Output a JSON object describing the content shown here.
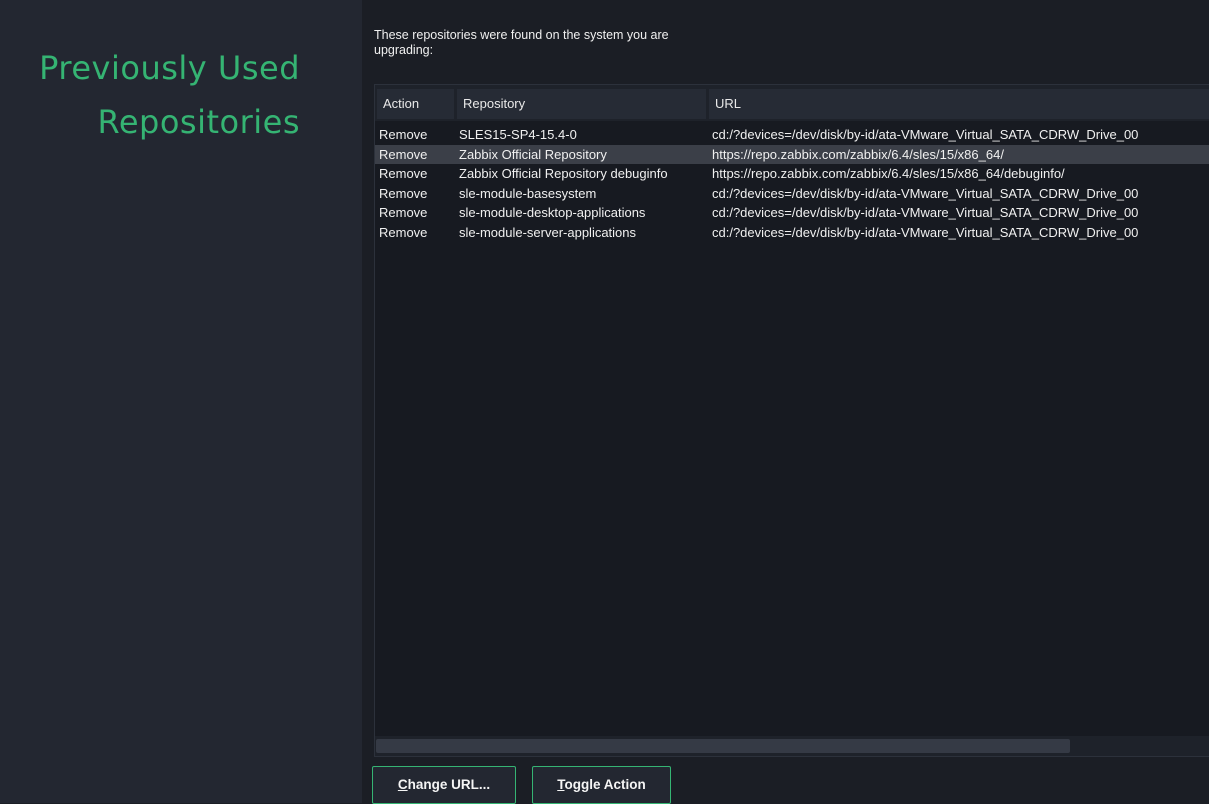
{
  "sidebar": {
    "title": "Previously Used\n  Repositories"
  },
  "intro_text": "These repositories were found on the system you are upgrading:",
  "table": {
    "columns": [
      "Action",
      "Repository",
      "URL"
    ],
    "rows": [
      {
        "action": "Remove",
        "repository": "SLES15-SP4-15.4-0",
        "url": "cd:/?devices=/dev/disk/by-id/ata-VMware_Virtual_SATA_CDRW_Drive_00",
        "selected": false
      },
      {
        "action": "Remove",
        "repository": "Zabbix Official Repository",
        "url": "https://repo.zabbix.com/zabbix/6.4/sles/15/x86_64/",
        "selected": true
      },
      {
        "action": "Remove",
        "repository": "Zabbix Official Repository debuginfo",
        "url": "https://repo.zabbix.com/zabbix/6.4/sles/15/x86_64/debuginfo/",
        "selected": false
      },
      {
        "action": "Remove",
        "repository": "sle-module-basesystem",
        "url": "cd:/?devices=/dev/disk/by-id/ata-VMware_Virtual_SATA_CDRW_Drive_00",
        "selected": false
      },
      {
        "action": "Remove",
        "repository": "sle-module-desktop-applications",
        "url": "cd:/?devices=/dev/disk/by-id/ata-VMware_Virtual_SATA_CDRW_Drive_00",
        "selected": false
      },
      {
        "action": "Remove",
        "repository": "sle-module-server-applications",
        "url": "cd:/?devices=/dev/disk/by-id/ata-VMware_Virtual_SATA_CDRW_Drive_00",
        "selected": false
      }
    ]
  },
  "buttons": {
    "change_url": {
      "mnemonic": "C",
      "rest": "hange URL..."
    },
    "toggle_action": {
      "mnemonic": "T",
      "rest": "oggle Action"
    }
  },
  "colors": {
    "accent": "#35b473",
    "sidebar_bg": "#232731",
    "main_bg": "#1b1e25",
    "selected_row": "#3b3f48"
  }
}
